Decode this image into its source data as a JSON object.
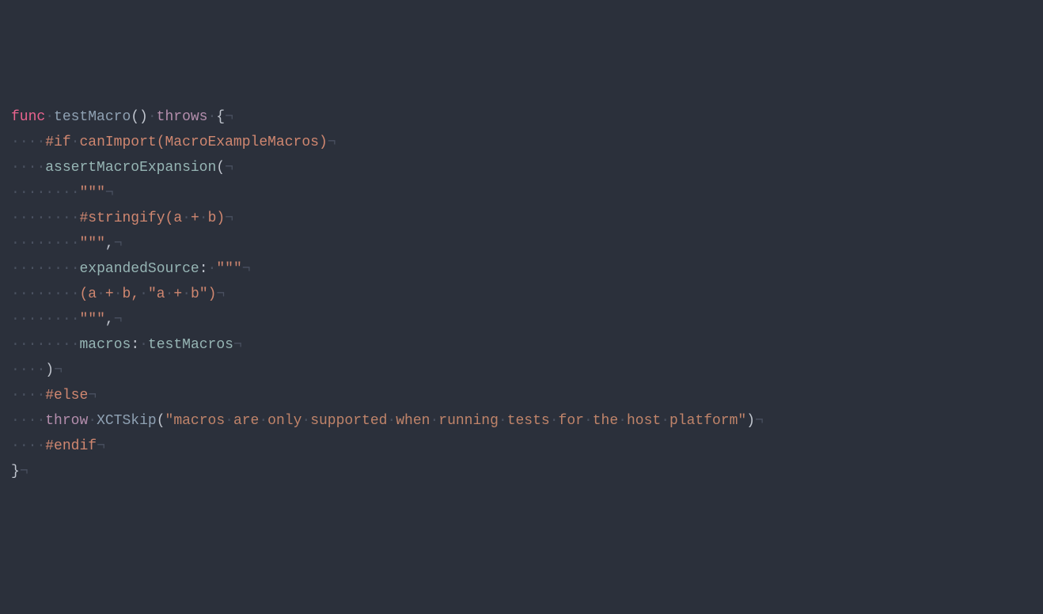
{
  "code": {
    "lines": [
      {
        "indent": 0,
        "tokens": [
          {
            "t": "func",
            "cls": "kw-func"
          },
          {
            "t": "·",
            "cls": "ws"
          },
          {
            "t": "testMacro",
            "cls": "fn-name"
          },
          {
            "t": "()",
            "cls": "punct"
          },
          {
            "t": "·",
            "cls": "ws"
          },
          {
            "t": "throws",
            "cls": "kw-throws"
          },
          {
            "t": "·",
            "cls": "ws"
          },
          {
            "t": "{",
            "cls": "punct"
          },
          {
            "t": "¬",
            "cls": "ws"
          }
        ]
      },
      {
        "indent": 4,
        "tokens": [
          {
            "t": "#if",
            "cls": "directive"
          },
          {
            "t": "·",
            "cls": "ws"
          },
          {
            "t": "canImport",
            "cls": "directive"
          },
          {
            "t": "(",
            "cls": "directive"
          },
          {
            "t": "MacroExampleMacros",
            "cls": "directive"
          },
          {
            "t": ")",
            "cls": "directive"
          },
          {
            "t": "¬",
            "cls": "ws"
          }
        ]
      },
      {
        "indent": 4,
        "tokens": [
          {
            "t": "assertMacroExpansion",
            "cls": "call2"
          },
          {
            "t": "(",
            "cls": "punct"
          },
          {
            "t": "¬",
            "cls": "ws"
          }
        ]
      },
      {
        "indent": 8,
        "tokens": [
          {
            "t": "\"\"\"",
            "cls": "string"
          },
          {
            "t": "¬",
            "cls": "ws"
          }
        ]
      },
      {
        "indent": 8,
        "tokens": [
          {
            "t": "#stringify(a",
            "cls": "string"
          },
          {
            "t": "·",
            "cls": "ws"
          },
          {
            "t": "+",
            "cls": "string"
          },
          {
            "t": "·",
            "cls": "ws"
          },
          {
            "t": "b)",
            "cls": "string"
          },
          {
            "t": "¬",
            "cls": "ws"
          }
        ]
      },
      {
        "indent": 8,
        "tokens": [
          {
            "t": "\"\"\"",
            "cls": "string"
          },
          {
            "t": ",",
            "cls": "punct"
          },
          {
            "t": "¬",
            "cls": "ws"
          }
        ]
      },
      {
        "indent": 8,
        "tokens": [
          {
            "t": "expandedSource",
            "cls": "param"
          },
          {
            "t": ":",
            "cls": "punct"
          },
          {
            "t": "·",
            "cls": "ws"
          },
          {
            "t": "\"\"\"",
            "cls": "string"
          },
          {
            "t": "¬",
            "cls": "ws"
          }
        ]
      },
      {
        "indent": 8,
        "tokens": [
          {
            "t": "(a",
            "cls": "string"
          },
          {
            "t": "·",
            "cls": "ws"
          },
          {
            "t": "+",
            "cls": "string"
          },
          {
            "t": "·",
            "cls": "ws"
          },
          {
            "t": "b,",
            "cls": "string"
          },
          {
            "t": "·",
            "cls": "ws"
          },
          {
            "t": "\"a",
            "cls": "string"
          },
          {
            "t": "·",
            "cls": "ws"
          },
          {
            "t": "+",
            "cls": "string"
          },
          {
            "t": "·",
            "cls": "ws"
          },
          {
            "t": "b\")",
            "cls": "string"
          },
          {
            "t": "¬",
            "cls": "ws"
          }
        ]
      },
      {
        "indent": 8,
        "tokens": [
          {
            "t": "\"\"\"",
            "cls": "string"
          },
          {
            "t": ",",
            "cls": "punct"
          },
          {
            "t": "¬",
            "cls": "ws"
          }
        ]
      },
      {
        "indent": 8,
        "tokens": [
          {
            "t": "macros",
            "cls": "param"
          },
          {
            "t": ":",
            "cls": "punct"
          },
          {
            "t": "·",
            "cls": "ws"
          },
          {
            "t": "testMacros",
            "cls": "call2"
          },
          {
            "t": "¬",
            "cls": "ws"
          }
        ]
      },
      {
        "indent": 4,
        "tokens": [
          {
            "t": ")",
            "cls": "punct"
          },
          {
            "t": "¬",
            "cls": "ws"
          }
        ]
      },
      {
        "indent": 4,
        "tokens": [
          {
            "t": "#else",
            "cls": "directive"
          },
          {
            "t": "¬",
            "cls": "ws"
          }
        ]
      },
      {
        "indent": 4,
        "tokens": [
          {
            "t": "throw",
            "cls": "kw-throw"
          },
          {
            "t": "·",
            "cls": "ws"
          },
          {
            "t": "XCTSkip",
            "cls": "type"
          },
          {
            "t": "(",
            "cls": "punct"
          },
          {
            "t": "\"macros",
            "cls": "string2"
          },
          {
            "t": "·",
            "cls": "ws"
          },
          {
            "t": "are",
            "cls": "string2"
          },
          {
            "t": "·",
            "cls": "ws"
          },
          {
            "t": "only",
            "cls": "string2"
          },
          {
            "t": "·",
            "cls": "ws"
          },
          {
            "t": "supported",
            "cls": "string2"
          },
          {
            "t": "·",
            "cls": "ws"
          },
          {
            "t": "when",
            "cls": "string2"
          },
          {
            "t": "·",
            "cls": "ws"
          },
          {
            "t": "running",
            "cls": "string2"
          },
          {
            "t": "·",
            "cls": "ws"
          },
          {
            "t": "tests",
            "cls": "string2"
          },
          {
            "t": "·",
            "cls": "ws"
          },
          {
            "t": "for",
            "cls": "string2"
          },
          {
            "t": "·",
            "cls": "ws"
          },
          {
            "t": "the",
            "cls": "string2"
          },
          {
            "t": "·",
            "cls": "ws"
          },
          {
            "t": "host",
            "cls": "string2"
          },
          {
            "t": "·",
            "cls": "ws"
          },
          {
            "t": "platform\"",
            "cls": "string2"
          },
          {
            "t": ")",
            "cls": "punct"
          },
          {
            "t": "¬",
            "cls": "ws"
          }
        ]
      },
      {
        "indent": 4,
        "tokens": [
          {
            "t": "#endif",
            "cls": "directive"
          },
          {
            "t": "¬",
            "cls": "ws"
          }
        ]
      },
      {
        "indent": 0,
        "tokens": [
          {
            "t": "}",
            "cls": "punct"
          },
          {
            "t": "¬",
            "cls": "ws"
          }
        ]
      }
    ]
  }
}
